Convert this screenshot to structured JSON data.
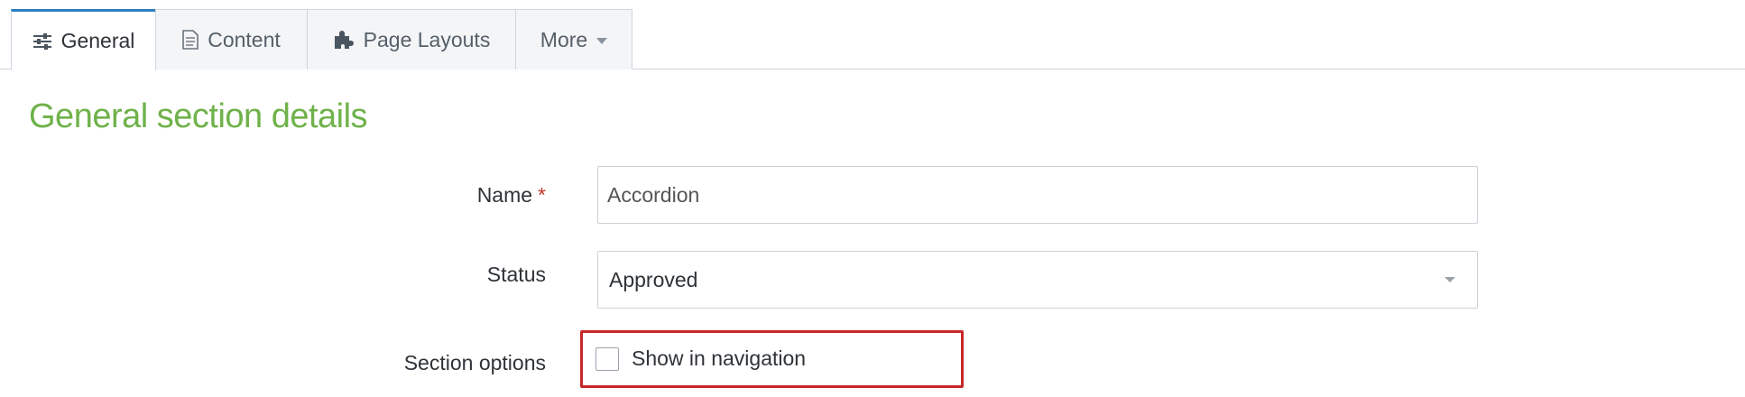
{
  "tabs": {
    "general": {
      "label": "General",
      "icon": "sliders-icon"
    },
    "content": {
      "label": "Content",
      "icon": "document-icon"
    },
    "page_layouts": {
      "label": "Page Layouts",
      "icon": "puzzle-icon"
    },
    "more": {
      "label": "More",
      "icon": "caret-down-icon"
    }
  },
  "section_title": "General section details",
  "form": {
    "name_label": "Name",
    "name_required_mark": "*",
    "name_value": "Accordion",
    "status_label": "Status",
    "status_value": "Approved",
    "section_options_label": "Section options",
    "options": [
      {
        "label": "Show in navigation",
        "checked": false
      }
    ]
  },
  "colors": {
    "accent_green": "#6fb24a",
    "active_tab_top": "#2f7fc1",
    "highlight_red": "#c62828",
    "required_red": "#c0392b"
  }
}
